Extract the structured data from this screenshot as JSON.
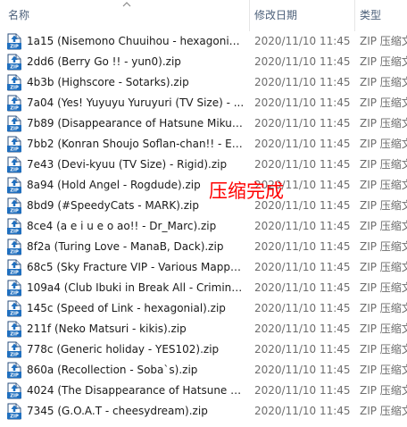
{
  "columns": {
    "name": "名称",
    "date": "修改日期",
    "type": "类型"
  },
  "colors": {
    "header_text": "#4c607a",
    "overlay": "#ff0000",
    "zip_icon_blue": "#1f6fbf"
  },
  "icons": {
    "sort": "chevron-up-icon",
    "file": "zip-archive-icon"
  },
  "files": [
    {
      "name": "1a15 (Nisemono Chuuihou - hexagonial...",
      "date": "2020/11/10 11:45",
      "type": "ZIP 压缩文"
    },
    {
      "name": "2dd6 (Berry Go !! - yun0).zip",
      "date": "2020/11/10 11:45",
      "type": "ZIP 压缩文"
    },
    {
      "name": "4b3b (Highscore - Sotarks).zip",
      "date": "2020/11/10 11:45",
      "type": "ZIP 压缩文"
    },
    {
      "name": "7a04 (Yes! Yuyuyu  Yuruyuri (TV Size) - ...",
      "date": "2020/11/10 11:45",
      "type": "ZIP 压缩文"
    },
    {
      "name": "7b89 (Disappearance of Hatsune Miku -...",
      "date": "2020/11/10 11:45",
      "type": "ZIP 压缩文"
    },
    {
      "name": "7bb2 (Konran Shoujo Soflan-chan!! - Ek...",
      "date": "2020/11/10 11:45",
      "type": "ZIP 压缩文"
    },
    {
      "name": "7e43 (Devi-kyuu (TV Size) - Rigid).zip",
      "date": "2020/11/10 11:45",
      "type": "ZIP 压缩文"
    },
    {
      "name": "8a94 (Hold Angel - Rogdude).zip",
      "date": "2020/11/10 11:45",
      "type": "ZIP 压缩文"
    },
    {
      "name": "8bd9 (#SpeedyCats - MARK).zip",
      "date": "2020/11/10 11:45",
      "type": "ZIP 压缩文"
    },
    {
      "name": "8ce4 (a e i u e o ao!! - Dr_Marc).zip",
      "date": "2020/11/10 11:45",
      "type": "ZIP 压缩文"
    },
    {
      "name": "8f2a (Turing Love - ManaB, Dack).zip",
      "date": "2020/11/10 11:45",
      "type": "ZIP 压缩文"
    },
    {
      "name": "68c5 (Sky Fracture VIP - Various Mappe...",
      "date": "2020/11/10 11:45",
      "type": "ZIP 压缩文"
    },
    {
      "name": "109a4 (Club Ibuki in Break All - Criminal...",
      "date": "2020/11/10 11:45",
      "type": "ZIP 压缩文"
    },
    {
      "name": "145c (Speed of Link - hexagonial).zip",
      "date": "2020/11/10 11:45",
      "type": "ZIP 压缩文"
    },
    {
      "name": "211f (Neko Matsuri - kikis).zip",
      "date": "2020/11/10 11:45",
      "type": "ZIP 压缩文"
    },
    {
      "name": "778c (Generic holiday - YES102).zip",
      "date": "2020/11/10 11:45",
      "type": "ZIP 压缩文"
    },
    {
      "name": "860a (Recollection - Soba`s).zip",
      "date": "2020/11/10 11:45",
      "type": "ZIP 压缩文"
    },
    {
      "name": "4024 (The Disappearance of Hatsune M...",
      "date": "2020/11/10 11:45",
      "type": "ZIP 压缩文"
    },
    {
      "name": "7345 (G.O.A.T - cheesydream).zip",
      "date": "2020/11/10 11:45",
      "type": "ZIP 压缩文"
    }
  ],
  "overlay_text": "压缩完成"
}
